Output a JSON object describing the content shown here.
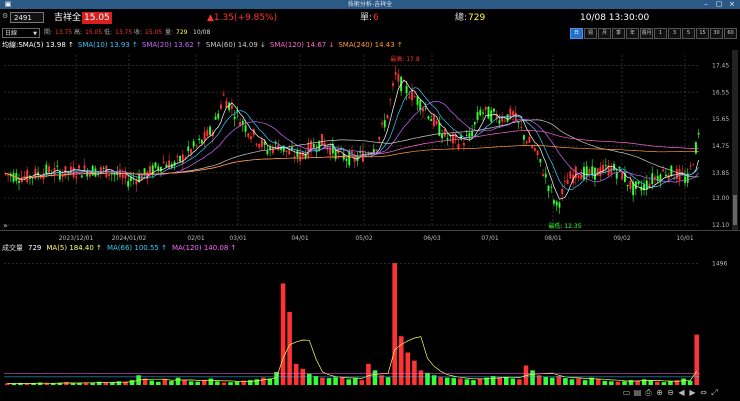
{
  "window": {
    "title": "技術分析-吉祥全"
  },
  "quote": {
    "code": "2491",
    "name": "吉祥全",
    "price": "15.05",
    "change": "▲1.35(+9.85%)",
    "single_label": "單:",
    "single_value": "6",
    "total_label": "總:",
    "total_value": "729",
    "datetime": "10/08 13:30:00"
  },
  "toolbar2": {
    "period_select": "日線",
    "open_label": "開:",
    "open": "13.75",
    "high_label": "高:",
    "high": "15.05",
    "low_label": "低:",
    "low": "13.75",
    "close_label": "收:",
    "close": "15.05",
    "vol_label": "量:",
    "vol": "729",
    "date": "10/08",
    "period_buttons": [
      {
        "label": "日",
        "on": true
      },
      {
        "label": "週",
        "on": false
      },
      {
        "label": "月",
        "on": false
      },
      {
        "label": "季",
        "on": false
      },
      {
        "label": "年",
        "on": false
      },
      {
        "label": "週月",
        "on": false
      },
      {
        "label": "1",
        "on": false
      },
      {
        "label": "3",
        "on": false
      },
      {
        "label": "5",
        "on": false
      },
      {
        "label": "15",
        "on": false
      },
      {
        "label": "30",
        "on": false
      },
      {
        "label": "60",
        "on": false
      }
    ]
  },
  "ma_legend": [
    {
      "text": "均線:SMA(5) 13.98 ↑",
      "color": "#ffffff"
    },
    {
      "text": "SMA(10) 13.93 ↑",
      "color": "#33ccff"
    },
    {
      "text": "SMA(20) 13.62 ↑",
      "color": "#cc66ff"
    },
    {
      "text": "SMA(60) 14.09 ↓",
      "color": "#cccccc"
    },
    {
      "text": "SMA(120) 14.67 ↓",
      "color": "#ff66cc"
    },
    {
      "text": "SMA(240) 14.43 ↑",
      "color": "#ff9933"
    }
  ],
  "vol_legend": [
    {
      "text": "成交量",
      "color": "#dddddd"
    },
    {
      "text": "729",
      "color": "#ffffff"
    },
    {
      "text": "MA(5) 184.40 ↑",
      "color": "#ffff66"
    },
    {
      "text": "MA(66) 100.55 ↑",
      "color": "#33ccff"
    },
    {
      "text": "MA(120) 140.08 ↑",
      "color": "#ff66ff"
    }
  ],
  "colors": {
    "up": "#ff3333",
    "down": "#33ff33",
    "bg": "#000000",
    "grid": "#333333"
  },
  "chart_data": {
    "type": "candlestick",
    "title": "",
    "price_axis": {
      "ticks": [
        "17.45",
        "16.55",
        "15.65",
        "14.75",
        "13.85",
        "13.00",
        "12.10"
      ],
      "ylim": [
        12.1,
        17.8
      ]
    },
    "volume_axis": {
      "ticks": [
        "1496"
      ],
      "ylim": [
        0,
        1600
      ]
    },
    "x_ticks": [
      "2023/12/01",
      "2024/01/02",
      "02/01",
      "03/01",
      "04/01",
      "05/02",
      "06/03",
      "07/01",
      "08/01",
      "09/02",
      "10/01"
    ],
    "annotations": {
      "high": "最高: 17.8",
      "low": "最低: 12.35"
    },
    "price_path": [
      [
        0,
        13.8
      ],
      [
        8,
        13.7
      ],
      [
        15,
        13.9
      ],
      [
        22,
        13.85
      ],
      [
        30,
        13.95
      ],
      [
        38,
        13.9
      ],
      [
        45,
        13.6
      ],
      [
        52,
        13.8
      ],
      [
        58,
        14.2
      ],
      [
        62,
        14.1
      ],
      [
        68,
        14.6
      ],
      [
        72,
        14.9
      ],
      [
        76,
        15.3
      ],
      [
        80,
        16.4
      ],
      [
        84,
        15.9
      ],
      [
        88,
        15.4
      ],
      [
        92,
        15.0
      ],
      [
        96,
        14.6
      ],
      [
        100,
        14.8
      ],
      [
        104,
        14.5
      ],
      [
        108,
        14.4
      ],
      [
        112,
        14.7
      ],
      [
        116,
        14.9
      ],
      [
        120,
        14.6
      ],
      [
        124,
        14.4
      ],
      [
        128,
        14.3
      ],
      [
        132,
        14.5
      ],
      [
        136,
        14.8
      ],
      [
        140,
        15.8
      ],
      [
        143,
        17.1
      ],
      [
        146,
        16.7
      ],
      [
        150,
        16.4
      ],
      [
        154,
        16.0
      ],
      [
        158,
        15.4
      ],
      [
        162,
        15.0
      ],
      [
        166,
        14.9
      ],
      [
        170,
        15.0
      ],
      [
        174,
        15.9
      ],
      [
        178,
        15.8
      ],
      [
        182,
        15.7
      ],
      [
        186,
        15.8
      ],
      [
        190,
        15.1
      ],
      [
        194,
        14.6
      ],
      [
        198,
        13.7
      ],
      [
        202,
        12.7
      ],
      [
        206,
        13.6
      ],
      [
        210,
        13.9
      ],
      [
        214,
        13.8
      ],
      [
        218,
        13.9
      ],
      [
        222,
        14.0
      ],
      [
        226,
        13.8
      ],
      [
        230,
        13.3
      ],
      [
        234,
        13.4
      ],
      [
        238,
        13.7
      ],
      [
        242,
        13.9
      ],
      [
        246,
        13.8
      ],
      [
        250,
        13.6
      ],
      [
        254,
        15.05
      ]
    ],
    "volume": [
      20,
      18,
      25,
      15,
      20,
      30,
      22,
      18,
      26,
      35,
      20,
      24,
      28,
      30,
      40,
      25,
      30,
      45,
      38,
      60,
      120,
      80,
      55,
      40,
      70,
      50,
      90,
      60,
      45,
      40,
      60,
      80,
      45,
      30,
      35,
      40,
      55,
      60,
      70,
      90,
      80,
      160,
      1250,
      900,
      260,
      200,
      140,
      110,
      90,
      85,
      95,
      100,
      70,
      80,
      60,
      260,
      180,
      120,
      95,
      1500,
      600,
      400,
      300,
      180,
      150,
      120,
      100,
      90,
      85,
      80,
      70,
      60,
      80,
      90,
      110,
      95,
      100,
      80,
      70,
      240,
      180,
      120,
      100,
      90,
      110,
      85,
      70,
      80,
      60,
      90,
      70,
      50,
      45,
      40,
      45,
      60,
      55,
      70,
      50,
      40,
      35,
      45,
      60,
      80,
      50,
      620
    ]
  }
}
